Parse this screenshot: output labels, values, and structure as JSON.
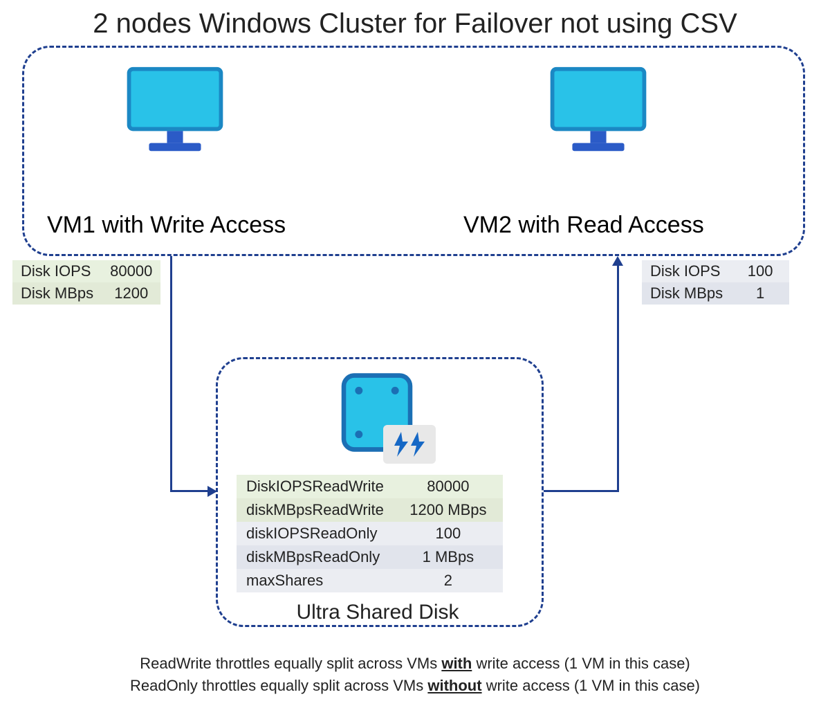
{
  "title": "2 nodes Windows Cluster for Failover not using CSV",
  "vm1": {
    "label": "VM1 with Write Access",
    "rows": [
      {
        "k": "Disk IOPS",
        "v": "80000"
      },
      {
        "k": "Disk MBps",
        "v": "1200"
      }
    ]
  },
  "vm2": {
    "label": "VM2 with Read Access",
    "rows": [
      {
        "k": "Disk IOPS",
        "v": "100"
      },
      {
        "k": "Disk MBps",
        "v": "1"
      }
    ]
  },
  "disk": {
    "caption": "Ultra Shared Disk",
    "rows": [
      {
        "k": "DiskIOPSReadWrite",
        "v": "80000"
      },
      {
        "k": "diskMBpsReadWrite",
        "v": "1200 MBps"
      },
      {
        "k": "diskIOPSReadOnly",
        "v": "100"
      },
      {
        "k": "diskMBpsReadOnly",
        "v": "1 MBps"
      },
      {
        "k": "maxShares",
        "v": "2"
      }
    ]
  },
  "footer": {
    "line1_a": "ReadWrite throttles equally split across VMs ",
    "line1_b": "with",
    "line1_c": " write access (1 VM in this case)",
    "line2_a": "ReadOnly throttles equally split across VMs ",
    "line2_b": "without",
    "line2_c": " write access (1 VM in this case)"
  }
}
